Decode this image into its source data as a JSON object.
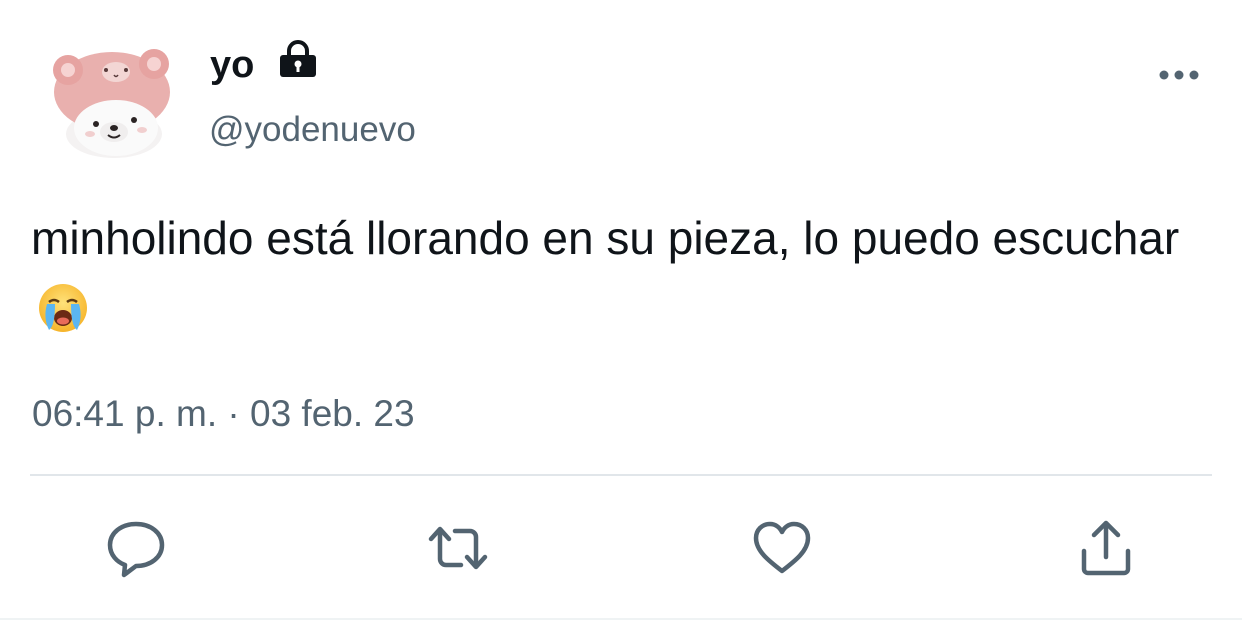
{
  "tweet": {
    "author": {
      "display_name": "yo",
      "handle": "@yodenuevo",
      "protected_icon": "lock-icon",
      "avatar": "bear-avatar"
    },
    "text": "minholindo está llorando en su pieza, lo puedo escuchar",
    "emoji": "loudly-crying-face",
    "time": "06:41 p. m.",
    "separator": "·",
    "date": "03 feb. 23",
    "menu_icon": "more-icon"
  },
  "actions": {
    "reply_icon": "reply-icon",
    "retweet_icon": "retweet-icon",
    "like_icon": "heart-icon",
    "share_icon": "share-icon"
  },
  "colors": {
    "text": "#0f1419",
    "secondary": "#536471",
    "divider": "#e1e6ea",
    "avatar_pink": "#e8aaa8"
  }
}
